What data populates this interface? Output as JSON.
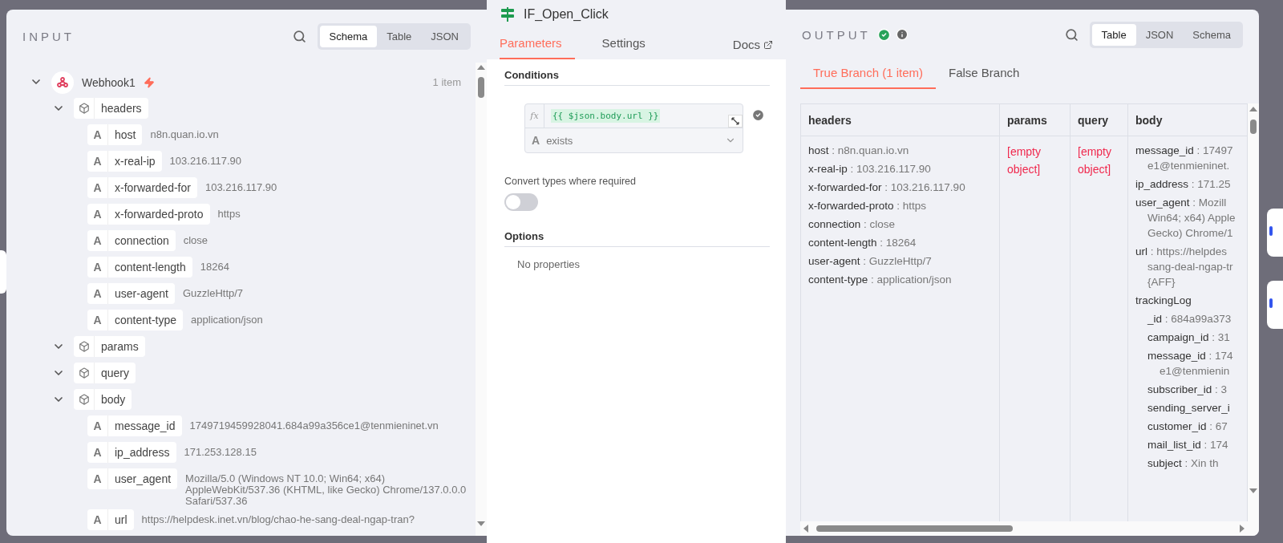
{
  "input": {
    "title": "INPUT",
    "view_tabs": [
      {
        "label": "Schema",
        "selected": true
      },
      {
        "label": "Table",
        "selected": false
      },
      {
        "label": "JSON",
        "selected": false
      }
    ],
    "tree": [
      {
        "kind": "node",
        "label": "Webhook1",
        "count": "1 item",
        "expanded": true,
        "children": [
          {
            "kind": "object",
            "key": "headers",
            "expanded": true,
            "children": [
              {
                "kind": "string",
                "glyph": "A",
                "key": "host",
                "value": "n8n.quan.io.vn"
              },
              {
                "kind": "string",
                "glyph": "A",
                "key": "x-real-ip",
                "value": "103.216.117.90"
              },
              {
                "kind": "string",
                "glyph": "A",
                "key": "x-forwarded-for",
                "value": "103.216.117.90"
              },
              {
                "kind": "string",
                "glyph": "A",
                "key": "x-forwarded-proto",
                "value": "https"
              },
              {
                "kind": "string",
                "glyph": "A",
                "key": "connection",
                "value": "close"
              },
              {
                "kind": "string",
                "glyph": "A",
                "key": "content-length",
                "value": "18264"
              },
              {
                "kind": "string",
                "glyph": "A",
                "key": "user-agent",
                "value": "GuzzleHttp/7"
              },
              {
                "kind": "string",
                "glyph": "A",
                "key": "content-type",
                "value": "application/json"
              }
            ]
          },
          {
            "kind": "object",
            "key": "params",
            "expanded": true
          },
          {
            "kind": "object",
            "key": "query",
            "expanded": true
          },
          {
            "kind": "object",
            "key": "body",
            "expanded": true,
            "children": [
              {
                "kind": "string",
                "glyph": "A",
                "key": "message_id",
                "value": "1749719459928041.684a99a356ce1@tenmieninet.vn"
              },
              {
                "kind": "string",
                "glyph": "A",
                "key": "ip_address",
                "value": "171.253.128.15"
              },
              {
                "kind": "string",
                "glyph": "A",
                "key": "user_agent",
                "value": "Mozilla/5.0 (Windows NT 10.0; Win64; x64) AppleWebKit/537.36 (KHTML, like Gecko) Chrome/137.0.0.0 Safari/537.36"
              },
              {
                "kind": "string",
                "glyph": "A",
                "key": "url",
                "value": "https://helpdesk.inet.vn/blog/chao-he-sang-deal-ngap-tran?"
              }
            ]
          }
        ]
      }
    ]
  },
  "node": {
    "title": "IF_Open_Click",
    "tabs": [
      {
        "label": "Parameters",
        "selected": true
      },
      {
        "label": "Settings",
        "selected": false
      }
    ],
    "docs": "Docs",
    "conditions": {
      "heading": "Conditions",
      "fx": "fx",
      "expression": "{{ $json.body.url }}",
      "operator_glyph": "A",
      "operator": "exists"
    },
    "convert_types": {
      "label": "Convert types where required",
      "on": false
    },
    "options": {
      "heading": "Options",
      "empty": "No properties"
    }
  },
  "output": {
    "title": "OUTPUT",
    "view_tabs": [
      {
        "label": "Table",
        "selected": true
      },
      {
        "label": "JSON",
        "selected": false
      },
      {
        "label": "Schema",
        "selected": false
      }
    ],
    "branch_tabs": [
      {
        "label": "True Branch (1 item)",
        "selected": true
      },
      {
        "label": "False Branch",
        "selected": false
      }
    ],
    "table": {
      "columns": [
        "headers",
        "params",
        "query",
        "body"
      ],
      "cells": [
        {
          "kind": "pairs",
          "items": [
            {
              "key": "host",
              "lines": [
                ": n8n.quan.io.vn"
              ]
            },
            {
              "key": "x-real-ip",
              "lines": [
                ": 103.216.117.90"
              ]
            },
            {
              "key": "x-forwarded-for",
              "lines": [
                ": 103.216.117.90"
              ]
            },
            {
              "key": "x-forwarded-proto",
              "lines": [
                ": https"
              ]
            },
            {
              "key": "connection",
              "lines": [
                ": close"
              ]
            },
            {
              "key": "content-length",
              "lines": [
                ": 18264"
              ]
            },
            {
              "key": "user-agent",
              "lines": [
                ": GuzzleHttp/7"
              ]
            },
            {
              "key": "content-type",
              "lines": [
                ": application/json"
              ]
            }
          ]
        },
        {
          "kind": "empty",
          "text": "[empty object]"
        },
        {
          "kind": "empty",
          "text": "[empty object]"
        },
        {
          "kind": "pairs",
          "items": [
            {
              "key": "message_id",
              "lines": [
                ": 17497",
                "e1@tenmieninet."
              ]
            },
            {
              "key": "ip_address",
              "lines": [
                ": 171.25"
              ]
            },
            {
              "key": "user_agent",
              "lines": [
                ": Mozill",
                "Win64; x64) Apple",
                "Gecko) Chrome/1"
              ]
            },
            {
              "key": "url",
              "lines": [
                ": https://helpdes",
                "sang-deal-ngap-tr",
                "{AFF}"
              ]
            },
            {
              "key": "trackingLog",
              "children": [
                {
                  "key": "_id",
                  "lines": [
                    ": 684a99a373"
                  ]
                },
                {
                  "key": "campaign_id",
                  "lines": [
                    ": 31"
                  ]
                },
                {
                  "key": "message_id",
                  "lines": [
                    ": 174",
                    "e1@tenmienin"
                  ]
                },
                {
                  "key": "subscriber_id",
                  "lines": [
                    ": 3"
                  ]
                },
                {
                  "key": "sending_server_i"
                },
                {
                  "key": "customer_id",
                  "lines": [
                    ": 67"
                  ]
                },
                {
                  "key": "mail_list_id",
                  "lines": [
                    ": 174"
                  ]
                },
                {
                  "key": "subject",
                  "lines": [
                    ": Xin th"
                  ]
                }
              ]
            }
          ]
        }
      ]
    }
  }
}
